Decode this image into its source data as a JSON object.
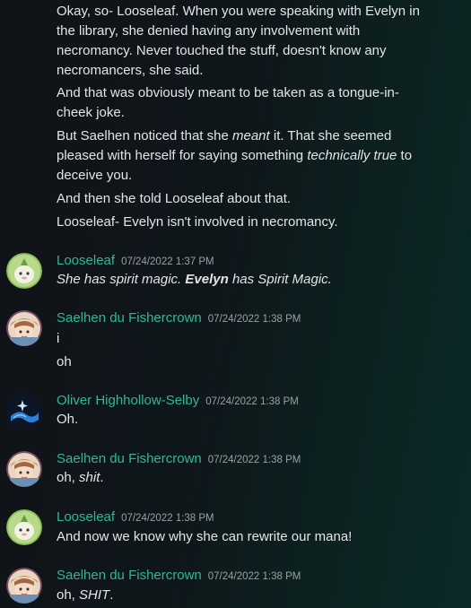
{
  "top_messages": [
    [
      "Okay, so- Looseleaf. When you were speaking with Evelyn in",
      "the library, she denied having any involvement with",
      "necromancy. Never touched the stuff, doesn't know any",
      "necromancers, she said."
    ],
    [
      "And that was obviously meant to be taken as a tongue-in-",
      "cheek joke."
    ],
    [
      "But Saelhen noticed that she ",
      "meant",
      " it. That she seemed",
      "pleased with herself for saying something ",
      "technically true",
      " to",
      "deceive you."
    ],
    [
      "And then she told Looseleaf about that."
    ],
    [
      "Looseleaf- Evelyn isn't involved in necromancy."
    ]
  ],
  "messages": [
    {
      "author": "Looseleaf",
      "timestamp": "07/24/2022 1:37 PM",
      "lines": [
        {
          "parts": [
            {
              "t": "She has spirit magic. ",
              "i": true
            },
            {
              "t": "Evelyn",
              "i": true,
              "b": true
            },
            {
              "t": " has Spirit Magic.",
              "i": true
            }
          ]
        }
      ]
    },
    {
      "author": "Saelhen du Fishercrown",
      "timestamp": "07/24/2022 1:38 PM",
      "lines": [
        {
          "parts": [
            {
              "t": "i"
            }
          ]
        },
        {
          "parts": [
            {
              "t": "oh"
            }
          ]
        }
      ]
    },
    {
      "author": "Oliver Highhollow-Selby",
      "timestamp": "07/24/2022 1:38 PM",
      "lines": [
        {
          "parts": [
            {
              "t": "Oh."
            }
          ]
        }
      ]
    },
    {
      "author": "Saelhen du Fishercrown",
      "timestamp": "07/24/2022 1:38 PM",
      "lines": [
        {
          "parts": [
            {
              "t": "oh, "
            },
            {
              "t": "shit",
              "i": true
            },
            {
              "t": "."
            }
          ]
        }
      ]
    },
    {
      "author": "Looseleaf",
      "timestamp": "07/24/2022 1:38 PM",
      "lines": [
        {
          "parts": [
            {
              "t": "And now we know why she can rewrite our mana!"
            }
          ]
        }
      ]
    },
    {
      "author": "Saelhen du Fishercrown",
      "timestamp": "07/24/2022 1:38 PM",
      "lines": [
        {
          "parts": [
            {
              "t": "oh, "
            },
            {
              "t": "SHIT",
              "i": true
            },
            {
              "t": "."
            }
          ]
        }
      ]
    }
  ],
  "avatars": {
    "Looseleaf": "leaf-creature-avatar-icon",
    "Saelhen du Fishercrown": "fisher-character-avatar-icon",
    "Oliver Highhollow-Selby": "sparkle-wave-avatar-icon"
  },
  "colors": {
    "username": "#2fb89a",
    "timestamp": "#9aa0a6",
    "text": "#e3e5e8"
  }
}
